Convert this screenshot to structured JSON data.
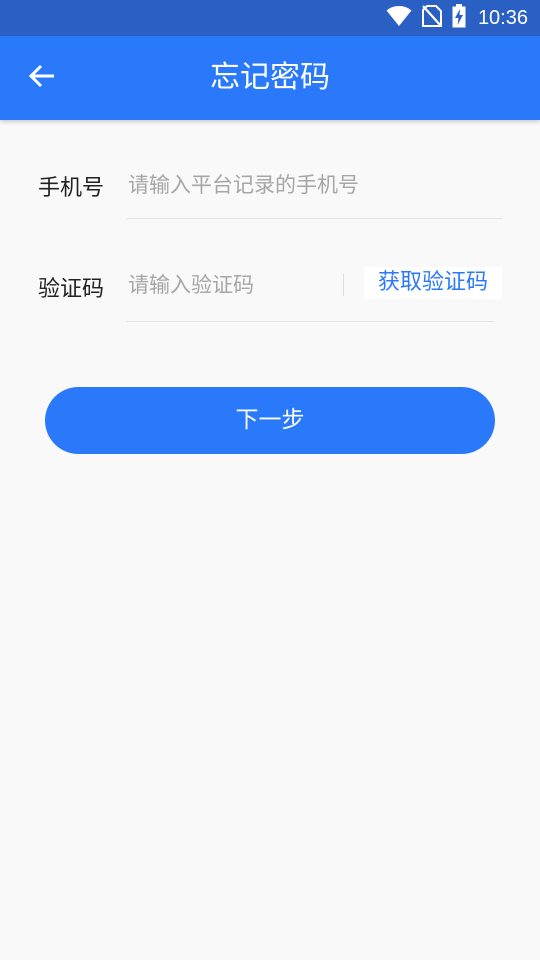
{
  "status_bar": {
    "time": "10:36",
    "icons": [
      "wifi-icon",
      "no-sim-icon",
      "battery-charging-icon"
    ]
  },
  "app_bar": {
    "back_icon": "arrow-left-icon",
    "title": "忘记密码"
  },
  "form": {
    "phone": {
      "label": "手机号",
      "placeholder": "请输入平台记录的手机号",
      "value": ""
    },
    "code": {
      "label": "验证码",
      "placeholder": "请输入验证码",
      "value": "",
      "get_code_label": "获取验证码"
    }
  },
  "next_button": {
    "label": "下一步"
  },
  "colors": {
    "primary": "#2b79fb",
    "status_bar": "#2a5fc4",
    "background": "#f9f9f9"
  }
}
